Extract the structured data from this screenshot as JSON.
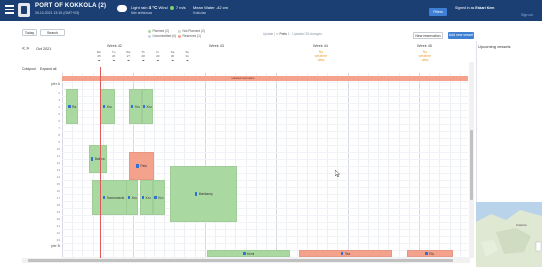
{
  "header": {
    "port_name": "PORT OF KOKKOLA (2)",
    "datetime": "26.10.2021 13:15 (GMT+03)",
    "weather": {
      "light_rain_label": "Light rain",
      "temp": "4 °C",
      "wind_label": "Wind",
      "wind_value": "7 m/s",
      "sub": "Näe arkistossa"
    },
    "water": {
      "label": "Mean Water",
      "value": "-42 cm",
      "sub": "Kokkolan"
    },
    "filters_label": "Filters",
    "signed_in_prefix": "Signed in as",
    "signed_in_user": "Eskari Kem",
    "sign_out_label": "Sign out"
  },
  "toolbar": {
    "today_label": "Today",
    "search_label": "Search",
    "legend": [
      {
        "label": "Planned (2)",
        "color": "#a9d9a1"
      },
      {
        "label": "Not Planned (2)",
        "color": "#d6d6d6"
      },
      {
        "label": "Uncommitted (0)",
        "color": "#c9d6ea"
      },
      {
        "label": "Reserved (1)",
        "color": "#f4a28c"
      }
    ],
    "status": {
      "update_label": "Update",
      "ports_label": "Ports",
      "ports_rest": "1 - Updated 28 changes"
    },
    "new_reservation_label": "New reservation",
    "add_visit_label": "Add new vessel"
  },
  "calendar": {
    "nav_arrows": "< >",
    "month": "Oct 2021",
    "weeks": [
      {
        "label": "Week 42"
      },
      {
        "label": "Week 43"
      },
      {
        "label": "Week 44"
      },
      {
        "label": "Week 45"
      }
    ],
    "day_labels": [
      "Mo",
      "Tu",
      "We",
      "Th",
      "Fr",
      "Sa",
      "Su"
    ],
    "day_numbers": [
      "25",
      "26",
      "27",
      "28",
      "29",
      "30",
      "31"
    ],
    "ice_labels": [
      {
        "line1": "No",
        "line2": "weather",
        "line3": "data"
      },
      {
        "line1": "No",
        "line2": "weather",
        "line3": "data"
      },
      {
        "line1": "No",
        "line2": "weather",
        "line3": "data"
      }
    ],
    "berth_header": "Coldpool",
    "berth_header_right": "Expand all",
    "berth_groups": [
      {
        "name": "Berth 1",
        "label": "pier A"
      },
      {
        "name": "Berth 2",
        "label": "pier B"
      }
    ],
    "row_numbers": [
      "1",
      "2",
      "3",
      "4",
      "5",
      "6",
      "7",
      "8",
      "9",
      "10",
      "11",
      "12",
      "13",
      "14",
      "15",
      "16",
      "17",
      "18",
      "19",
      "20",
      "21",
      "22",
      "23",
      "24",
      "25",
      "26"
    ],
    "top_banner": "Labeled reservation"
  },
  "bookings": [
    {
      "label": "Ra",
      "color": "green",
      "row_start": 1,
      "row_end": 6,
      "day": 0.4,
      "width": 1.2
    },
    {
      "label": "Kru",
      "color": "green",
      "row_start": 1,
      "row_end": 6,
      "day": 3.7,
      "width": 1.5
    },
    {
      "label": "Kru",
      "color": "green",
      "row_start": 1,
      "row_end": 6,
      "day": 6.6,
      "width": 1.2
    },
    {
      "label": "Kru",
      "color": "green",
      "row_start": 1,
      "row_end": 6,
      "day": 7.8,
      "width": 1.1
    },
    {
      "label": "Baltica",
      "color": "green",
      "row_start": 9,
      "row_end": 13,
      "day": 2.6,
      "width": 1.8
    },
    {
      "label": "Pala",
      "color": "salmon",
      "row_start": 10,
      "row_end": 14,
      "day": 6.6,
      "width": 2.4
    },
    {
      "label": "Sommarsvik",
      "color": "green",
      "row_start": 14,
      "row_end": 19,
      "day": 2.9,
      "width": 4.3
    },
    {
      "label": "Kru",
      "color": "green",
      "row_start": 14,
      "row_end": 19,
      "day": 6.3,
      "width": 1.2
    },
    {
      "label": "Kru",
      "color": "green",
      "row_start": 14,
      "row_end": 19,
      "day": 7.6,
      "width": 1.3
    },
    {
      "label": "Kru",
      "color": "green",
      "row_start": 14,
      "row_end": 19,
      "day": 8.9,
      "width": 1.2
    },
    {
      "label": "Marikamp",
      "color": "green",
      "row_start": 12,
      "row_end": 20,
      "day": 10.6,
      "width": 6.6
    },
    {
      "label": "Kemi",
      "color": "green",
      "row_start": 24,
      "row_end": 25,
      "day": 14.2,
      "width": 8.2
    },
    {
      "label": "Tea",
      "color": "salmon",
      "row_start": 24,
      "row_end": 25,
      "day": 23.2,
      "width": 9.2
    },
    {
      "label": "Rio",
      "color": "salmon",
      "row_start": 24,
      "row_end": 25,
      "day": 33.8,
      "width": 4.5
    }
  ],
  "side_panel": {
    "title": "Upcoming vessels"
  },
  "map": {
    "label": "Kokkola"
  }
}
